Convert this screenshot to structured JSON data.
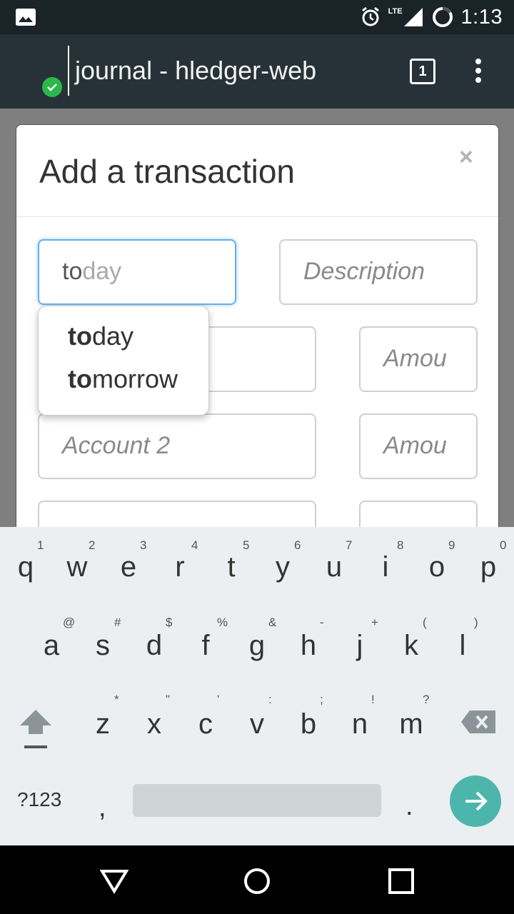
{
  "status_bar": {
    "time": "1:13",
    "network": "LTE"
  },
  "toolbar": {
    "title": "journal - hledger-web",
    "tab_count": "1"
  },
  "modal": {
    "title": "Add a transaction",
    "close": "×",
    "date_typed": "to",
    "date_hint": "day",
    "description_placeholder": "Description",
    "account2_placeholder": "Account 2",
    "amount1_placeholder": "Amou",
    "amount2_placeholder": "Amou"
  },
  "autocomplete": [
    {
      "bold": "to",
      "rest": "day"
    },
    {
      "bold": "to",
      "rest": "morrow"
    }
  ],
  "keyboard": {
    "row1": [
      [
        "q",
        "1"
      ],
      [
        "w",
        "2"
      ],
      [
        "e",
        "3"
      ],
      [
        "r",
        "4"
      ],
      [
        "t",
        "5"
      ],
      [
        "y",
        "6"
      ],
      [
        "u",
        "7"
      ],
      [
        "i",
        "8"
      ],
      [
        "o",
        "9"
      ],
      [
        "p",
        "0"
      ]
    ],
    "row2": [
      [
        "a",
        "@"
      ],
      [
        "s",
        "#"
      ],
      [
        "d",
        "$"
      ],
      [
        "f",
        "%"
      ],
      [
        "g",
        "&"
      ],
      [
        "h",
        "-"
      ],
      [
        "j",
        "+"
      ],
      [
        "k",
        "("
      ],
      [
        "l",
        ")"
      ]
    ],
    "row3": [
      [
        "z",
        "*"
      ],
      [
        "x",
        "\""
      ],
      [
        "c",
        "'"
      ],
      [
        "v",
        ":"
      ],
      [
        "b",
        ";"
      ],
      [
        "n",
        "!"
      ],
      [
        "m",
        "?"
      ]
    ],
    "symbols_label": "?123",
    "comma": ",",
    "period": "."
  },
  "colors": {
    "accent_enter": "#4db6ac",
    "focus_border": "#66afe9",
    "check_green": "#2ab84a"
  }
}
